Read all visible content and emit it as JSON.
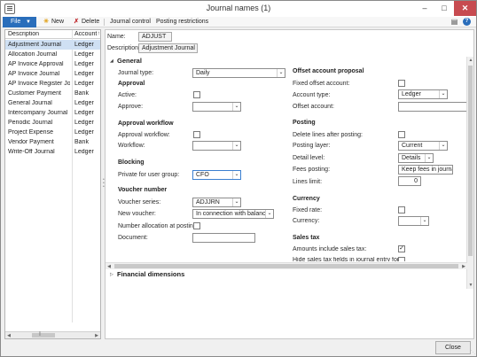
{
  "window": {
    "title": "Journal names (1)"
  },
  "menu": {
    "file": "File",
    "new": "New",
    "delete": "Delete",
    "journal_control": "Journal control",
    "posting_restrictions": "Posting restrictions"
  },
  "grid": {
    "columns": [
      "Description",
      "Account typ"
    ],
    "rows": [
      {
        "description": "Adjustment Journal",
        "type": "Ledger"
      },
      {
        "description": "Allocation Journal",
        "type": "Ledger"
      },
      {
        "description": "AP Invoice Approval",
        "type": "Ledger"
      },
      {
        "description": "AP Invoice Journal",
        "type": "Ledger"
      },
      {
        "description": "AP Invoice Register Jo...",
        "type": "Ledger"
      },
      {
        "description": "Customer Payment",
        "type": "Bank"
      },
      {
        "description": "General Journal",
        "type": "Ledger"
      },
      {
        "description": "Intercompany Journal",
        "type": "Ledger"
      },
      {
        "description": "Periodic Journal",
        "type": "Ledger"
      },
      {
        "description": "Project Expense",
        "type": "Ledger"
      },
      {
        "description": "Vendor Payment",
        "type": "Bank"
      },
      {
        "description": "Write-Off Journal",
        "type": "Ledger"
      }
    ]
  },
  "header": {
    "name_label": "Name:",
    "name_value": "ADJUST",
    "description_label": "Description:",
    "description_value": "Adjustment Journal"
  },
  "general": {
    "title": "General",
    "journal_type_label": "Journal type:",
    "journal_type_value": "Daily",
    "approval_title": "Approval",
    "active_label": "Active:",
    "approve_label": "Approve:",
    "approve_value": "",
    "approval_workflow_title": "Approval workflow",
    "approval_workflow_label": "Approval workflow:",
    "workflow_label": "Workflow:",
    "workflow_value": "",
    "blocking_title": "Blocking",
    "private_label": "Private for user group:",
    "private_value": "CFO",
    "voucher_title": "Voucher number",
    "voucher_series_label": "Voucher series:",
    "voucher_series_value": "ADJJRN",
    "new_voucher_label": "New voucher:",
    "new_voucher_value": "In connection with balance",
    "number_alloc_label": "Number allocation at posting:",
    "document_label": "Document:",
    "document_value": "",
    "offset_title": "Offset account proposal",
    "fixed_offset_label": "Fixed offset account:",
    "account_type_label": "Account type:",
    "account_type_value": "Ledger",
    "offset_account_label": "Offset account:",
    "offset_account_value": "",
    "posting_title": "Posting",
    "delete_lines_label": "Delete lines after posting:",
    "posting_layer_label": "Posting layer:",
    "posting_layer_value": "Current",
    "detail_level_label": "Detail level:",
    "detail_level_value": "Details",
    "fees_posting_label": "Fees posting:",
    "fees_posting_value": "Keep fees in journal",
    "lines_limit_label": "Lines limit:",
    "lines_limit_value": "0",
    "currency_title": "Currency",
    "fixed_rate_label": "Fixed rate:",
    "currency_label": "Currency:",
    "currency_value": "",
    "sales_tax_title": "Sales tax",
    "amounts_include_label": "Amounts include sales tax:",
    "hide_fields_label": "Hide sales tax fields in journal entry forms:"
  },
  "financial_dimensions": {
    "title": "Financial dimensions"
  },
  "footer": {
    "close": "Close"
  }
}
